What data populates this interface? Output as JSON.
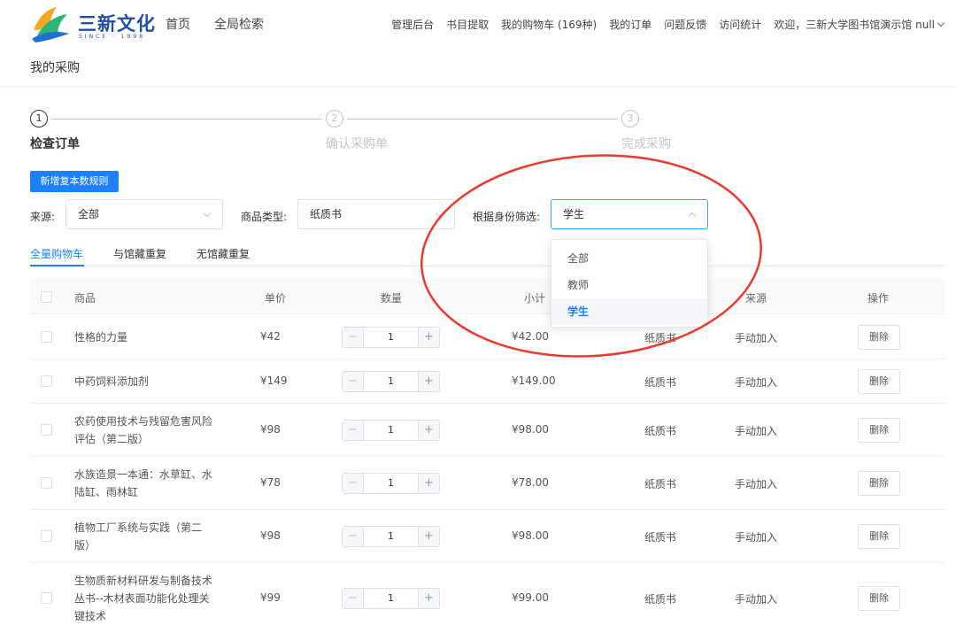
{
  "header": {
    "brand": "三新文化",
    "brand_sub": "SINCE · 1998",
    "main_nav": [
      "首页",
      "全局检索"
    ],
    "top_nav": [
      "管理后台",
      "书目提取",
      "我的购物车 (169种)",
      "我的订单",
      "问题反馈",
      "访问统计"
    ],
    "welcome": "欢迎，三新大学图书馆演示馆 null",
    "accent_color": "#1e80ff"
  },
  "page_title": "我的采购",
  "steps": [
    {
      "num": "1",
      "label": "检查订单",
      "state": "active"
    },
    {
      "num": "2",
      "label": "确认采购单",
      "state": "inactive"
    },
    {
      "num": "3",
      "label": "完成采购",
      "state": "inactive"
    }
  ],
  "add_rule_button": "新增复本数规则",
  "filters": {
    "source_label": "来源:",
    "source_value": "全部",
    "type_label": "商品类型:",
    "type_value": "纸质书",
    "identity_label": "根据身份筛选:",
    "identity_value": "学生"
  },
  "identity_options": [
    "全部",
    "教师",
    "学生"
  ],
  "tabs": [
    "全量购物车",
    "与馆藏重复",
    "无馆藏重复"
  ],
  "columns": {
    "product": "商品",
    "price": "单价",
    "quantity": "数量",
    "subtotal": "小计",
    "type": "",
    "source": "来源",
    "action": "操作"
  },
  "rows": [
    {
      "name": "性格的力量",
      "price": "¥42",
      "qty": "1",
      "subtotal": "¥42.00",
      "type": "纸质书",
      "source": "手动加入",
      "action": "删除"
    },
    {
      "name": "中药饲料添加剂",
      "price": "¥149",
      "qty": "1",
      "subtotal": "¥149.00",
      "type": "纸质书",
      "source": "手动加入",
      "action": "删除"
    },
    {
      "name": "农药使用技术与残留危害风险评估（第二版）",
      "price": "¥98",
      "qty": "1",
      "subtotal": "¥98.00",
      "type": "纸质书",
      "source": "手动加入",
      "action": "删除"
    },
    {
      "name": "水族造景一本通：水草缸、水陆缸、雨林缸",
      "price": "¥78",
      "qty": "1",
      "subtotal": "¥78.00",
      "type": "纸质书",
      "source": "手动加入",
      "action": "删除"
    },
    {
      "name": "植物工厂系统与实践（第二版）",
      "price": "¥98",
      "qty": "1",
      "subtotal": "¥98.00",
      "type": "纸质书",
      "source": "手动加入",
      "action": "删除"
    },
    {
      "name": "生物质新材料研发与制备技术丛书--木材表面功能化处理关键技术",
      "price": "¥99",
      "qty": "1",
      "subtotal": "¥99.00",
      "type": "纸质书",
      "source": "手动加入",
      "action": "删除"
    }
  ],
  "stepper": {
    "minus": "−",
    "plus": "+"
  }
}
